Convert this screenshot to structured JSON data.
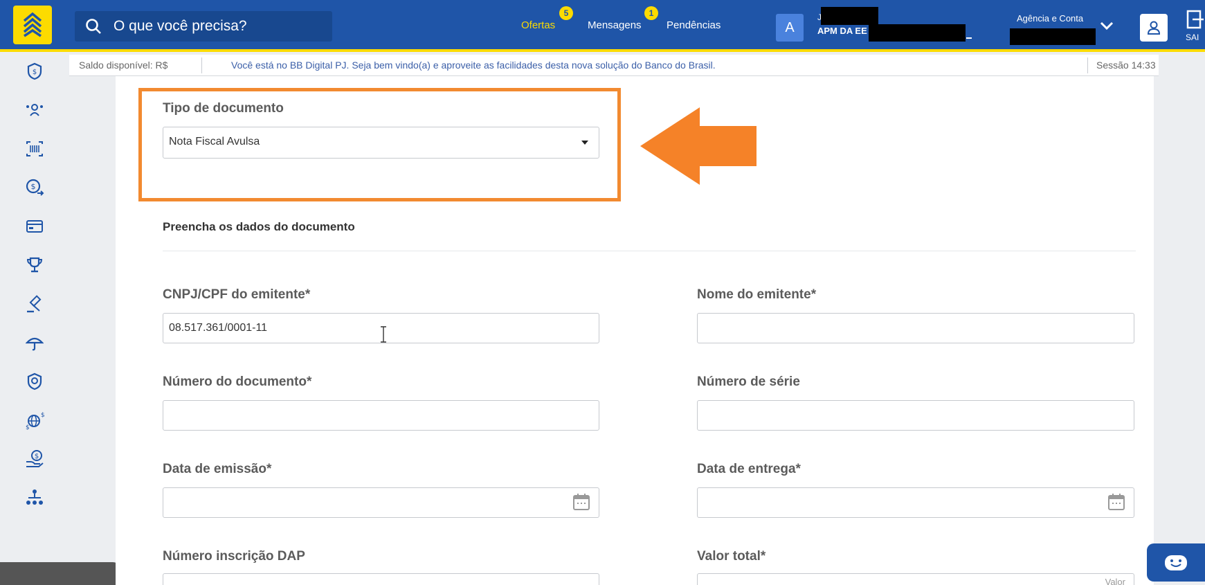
{
  "header": {
    "search_placeholder": "O que você precisa?",
    "nav": [
      {
        "label": "Ofertas",
        "badge": "5"
      },
      {
        "label": "Mensagens",
        "badge": "1"
      },
      {
        "label": "Pendências"
      }
    ],
    "avatar_letter": "A",
    "user_line1": "J",
    "user_line2": "APM DA EE",
    "agencia_label": "Agência e Conta",
    "sair_label": "SAI"
  },
  "subbar": {
    "saldo": "Saldo disponível: R$",
    "welcome": "Você está no BB Digital PJ. Seja bem vindo(a) e aproveite as facilidades desta nova solução do Banco do Brasil.",
    "sessao": "Sessão 14:33"
  },
  "sidebar": {
    "icons": [
      "shield-money-icon",
      "people-icon",
      "barcode-icon",
      "coin-transfer-icon",
      "card-icon",
      "trophy-icon",
      "auction-icon",
      "umbrella-icon",
      "badge-shield-icon",
      "global-money-icon",
      "hand-money-icon",
      "org-chart-icon"
    ]
  },
  "form": {
    "tipo_label": "Tipo de documento",
    "tipo_value": "Nota Fiscal Avulsa",
    "section_title": "Preencha os dados do documento",
    "cnpj_label": "CNPJ/CPF do emitente*",
    "cnpj_value": "08.517.361/0001-11",
    "nome_label": "Nome do emitente*",
    "nome_value": "",
    "numero_doc_label": "Número do documento*",
    "numero_serie_label": "Número de série",
    "data_emissao_label": "Data de emissão*",
    "data_entrega_label": "Data de entrega*",
    "dap_label": "Número inscrição DAP",
    "valor_label": "Valor total*",
    "valor_placeholder": "Valor"
  },
  "colors": {
    "brand_blue": "#1f55a8",
    "brand_yellow": "#fcdb00",
    "highlight_orange": "#f28a30"
  }
}
